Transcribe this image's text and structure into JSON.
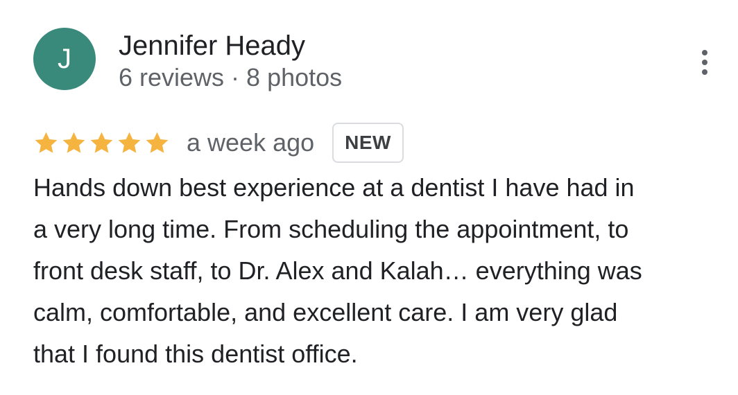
{
  "reviewer": {
    "initial": "J",
    "avatar_color": "#3a8a7b",
    "name": "Jennifer Heady",
    "meta": "6 reviews · 8 photos"
  },
  "menu": {
    "icon": "more-vert-icon"
  },
  "review": {
    "rating": 5,
    "rating_max": 5,
    "star_color": "#f4b43f",
    "time": "a week ago",
    "badge": "NEW",
    "text": "Hands down best experience at a dentist I have had in\na very long time.  From scheduling the appointment, to\nfront desk staff, to Dr. Alex and Kalah… everything was\ncalm, comfortable, and excellent care.  I am very glad\nthat I found this dentist office."
  }
}
